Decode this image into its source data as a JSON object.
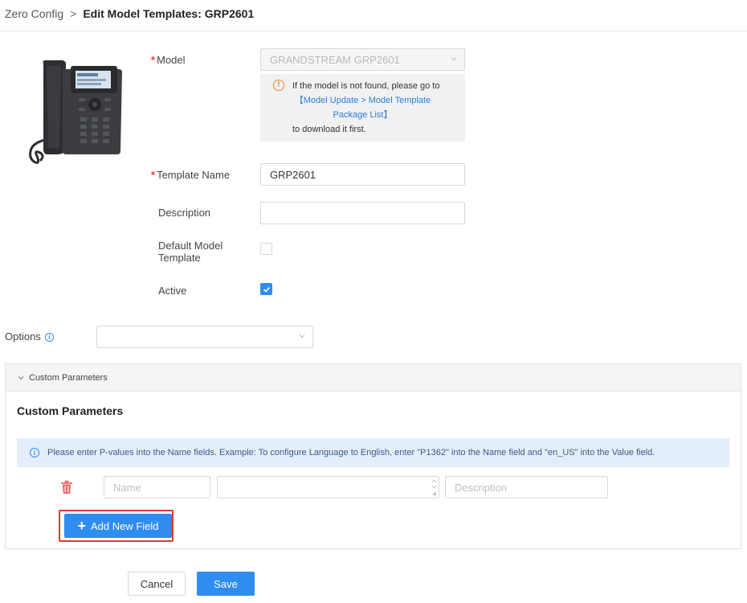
{
  "breadcrumb": {
    "parent": "Zero Config",
    "separator": ">",
    "current": "Edit Model Templates: GRP2601"
  },
  "form": {
    "model": {
      "label": "Model",
      "value": "GRANDSTREAM GRP2601",
      "note_line1": "If the model is not found, please go to",
      "note_link_line1": "【Model Update > Model Template",
      "note_link_line2": "Package List】",
      "note_line3": "to download it first."
    },
    "template_name": {
      "label": "Template Name",
      "value": "GRP2601"
    },
    "description": {
      "label": "Description",
      "value": ""
    },
    "default_model_template": {
      "label_line1": "Default Model",
      "label_line2": "Template",
      "checked": false
    },
    "active": {
      "label": "Active",
      "checked": true
    },
    "options": {
      "label": "Options",
      "value": ""
    }
  },
  "custom_parameters": {
    "section_header": "Custom Parameters",
    "title": "Custom Parameters",
    "alert": "Please enter P-values into the Name fields. Example: To configure Language to English, enter \"P1362\" into the Name field and \"en_US\" into the Value field.",
    "row": {
      "name_placeholder": "Name",
      "value": "",
      "description_placeholder": "Description"
    },
    "add_button": "Add New Field"
  },
  "actions": {
    "cancel": "Cancel",
    "save": "Save"
  },
  "colors": {
    "primary": "#2f8cf0",
    "required": "#e0412e",
    "warning": "#f0862a",
    "highlight_frame": "#e03a2e"
  }
}
